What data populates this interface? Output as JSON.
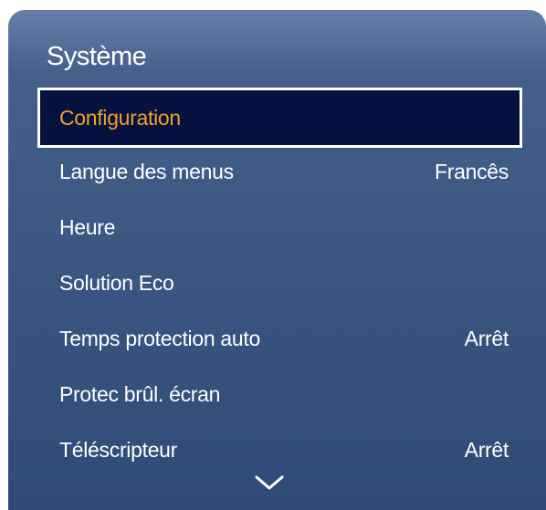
{
  "panel": {
    "title": "Système"
  },
  "menu": {
    "items": [
      {
        "label": "Configuration",
        "value": ""
      },
      {
        "label": "Langue des menus",
        "value": "Francês"
      },
      {
        "label": "Heure",
        "value": ""
      },
      {
        "label": "Solution Eco",
        "value": ""
      },
      {
        "label": "Temps protection auto",
        "value": "Arrêt"
      },
      {
        "label": "Protec brûl. écran",
        "value": ""
      },
      {
        "label": "Téléscripteur",
        "value": "Arrêt"
      }
    ],
    "selected_index": 0
  },
  "scroll_indicator": {
    "icon": "chevron-down-icon"
  },
  "colors": {
    "panel_top": "#6580aa",
    "panel_bottom": "#2f4a76",
    "selected_background": "#05113e",
    "selected_text": "#f3a02b",
    "text": "#ffffff"
  }
}
